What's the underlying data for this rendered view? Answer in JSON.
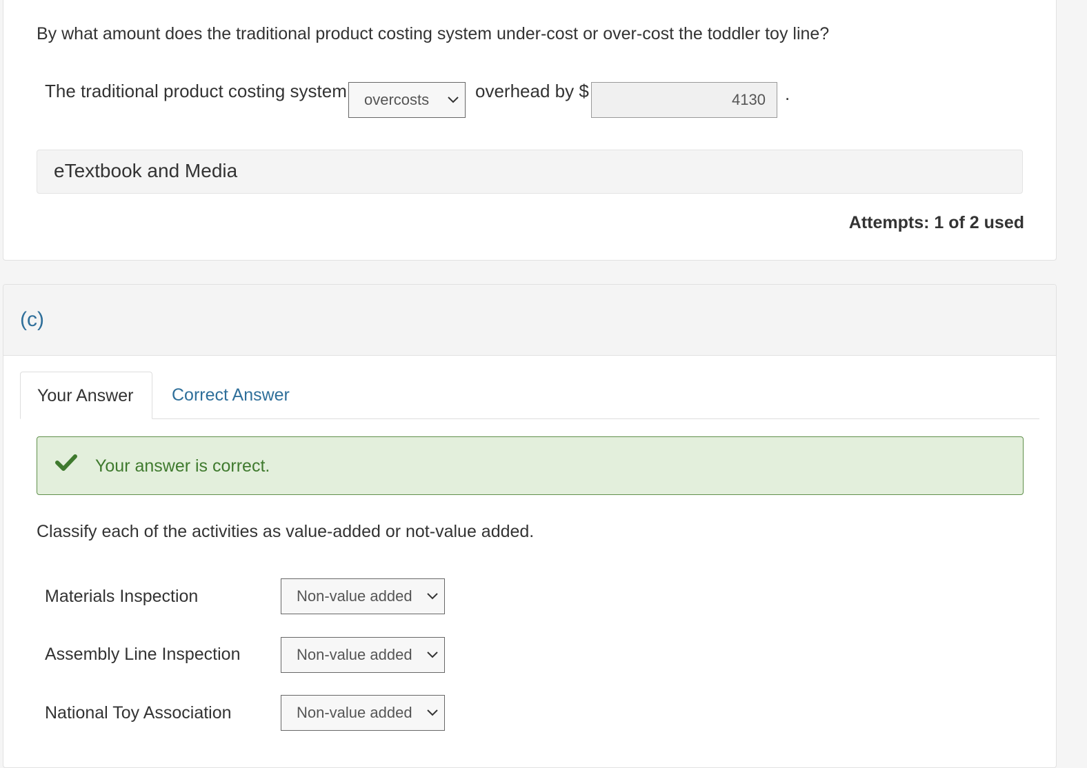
{
  "part_b": {
    "question": "By what amount does the traditional product costing system under-cost or over-cost the toddler toy line?",
    "sentence_prefix": "The traditional product costing system",
    "select_value": "overcosts",
    "sentence_middle": "overhead by $",
    "amount_value": "4130",
    "sentence_suffix": ".",
    "etextbook_label": "eTextbook and Media",
    "attempts": "Attempts: 1 of 2 used"
  },
  "part_c": {
    "label": "(c)",
    "tabs": [
      {
        "label": "Your Answer",
        "active": true
      },
      {
        "label": "Correct Answer",
        "active": false
      }
    ],
    "feedback": "Your answer is correct.",
    "instruction": "Classify each of the activities as value-added or not-value added.",
    "rows": [
      {
        "label": "Materials Inspection",
        "value": "Non-value added"
      },
      {
        "label": "Assembly Line Inspection",
        "value": "Non-value added"
      },
      {
        "label": "National Toy Association",
        "value": "Non-value added"
      }
    ]
  },
  "colors": {
    "link": "#2f6f9a",
    "success_bg": "#e3efdc",
    "success_border": "#5f8f4a",
    "success_text": "#3f7a2e"
  },
  "icons": [
    "chevron-down-icon",
    "checkmark-icon"
  ]
}
